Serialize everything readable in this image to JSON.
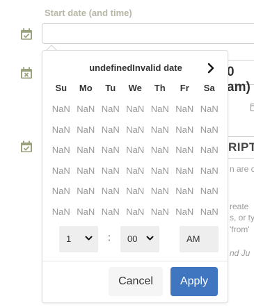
{
  "form": {
    "start_label": "Start date (and time)",
    "start_value": "",
    "end_time_fragment": "0 am)",
    "description_fragment": "RIPT",
    "fragment_lines": [
      "n are c",
      "reate",
      "s, or ty",
      "'from'",
      "nd Ju"
    ]
  },
  "picker": {
    "month_title": "undefinedInvalid date",
    "weekdays": [
      "Su",
      "Mo",
      "Tu",
      "We",
      "Th",
      "Fr",
      "Sa"
    ],
    "weeks": [
      [
        "NaN",
        "NaN",
        "NaN",
        "NaN",
        "NaN",
        "NaN",
        "NaN"
      ],
      [
        "NaN",
        "NaN",
        "NaN",
        "NaN",
        "NaN",
        "NaN",
        "NaN"
      ],
      [
        "NaN",
        "NaN",
        "NaN",
        "NaN",
        "NaN",
        "NaN",
        "NaN"
      ],
      [
        "NaN",
        "NaN",
        "NaN",
        "NaN",
        "NaN",
        "NaN",
        "NaN"
      ],
      [
        "NaN",
        "NaN",
        "NaN",
        "NaN",
        "NaN",
        "NaN",
        "NaN"
      ],
      [
        "NaN",
        "NaN",
        "NaN",
        "NaN",
        "NaN",
        "NaN",
        "NaN"
      ]
    ],
    "time": {
      "hour": "1",
      "separator": ":",
      "minute": "00",
      "ampm": "AM"
    },
    "cancel_label": "Cancel",
    "apply_label": "Apply"
  },
  "colors": {
    "apply_bg": "#3f76bf",
    "icon": "#9aa27d",
    "label": "#b7b7a6"
  }
}
